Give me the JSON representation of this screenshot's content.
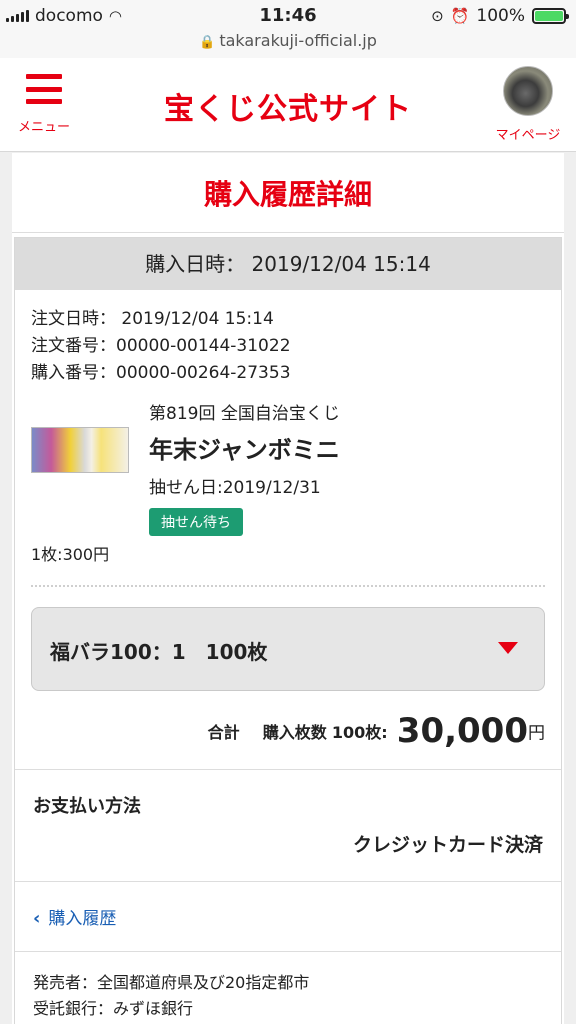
{
  "status_bar": {
    "carrier": "docomo",
    "time": "11:46",
    "battery": "100%"
  },
  "url_bar": {
    "domain": "takarakuji-official.jp"
  },
  "header": {
    "menu_label": "メニュー",
    "logo": "宝くじ公式サイト",
    "mypage_label": "マイページ"
  },
  "page": {
    "title": "購入履歴詳細",
    "purchase_datetime": "購入日時： 2019/12/04 15:14"
  },
  "order": {
    "order_datetime": "注文日時： 2019/12/04 15:14",
    "order_number": "注文番号：00000-00144-31022",
    "purchase_number": "購入番号：00000-00264-27353"
  },
  "product": {
    "round": "第819回 全国自治宝くじ",
    "name": "年末ジャンボミニ",
    "draw_date": "抽せん日:2019/12/31",
    "status_badge": "抽せん待ち",
    "unit_price": "1枚:300円"
  },
  "bara": {
    "label": "福バラ100：1　100枚"
  },
  "total": {
    "label": "合計",
    "count_label": "購入枚数",
    "count": "100枚:",
    "amount": "30,000",
    "yen": "円"
  },
  "payment": {
    "title": "お支払い方法",
    "method": "クレジットカード決済"
  },
  "back_link": {
    "label": "購入履歴"
  },
  "footer": {
    "seller": "発売者：全国都道府県及び20指定都市",
    "bank": "受託銀行：みずほ銀行"
  },
  "colors": {
    "brand_red": "#e60012",
    "badge_green": "#1d9c72",
    "link_blue": "#1a5fb4"
  },
  "icons": [
    "hamburger-icon",
    "lock-icon",
    "wifi-icon",
    "battery-icon",
    "caret-down-icon",
    "chevron-left-icon"
  ]
}
